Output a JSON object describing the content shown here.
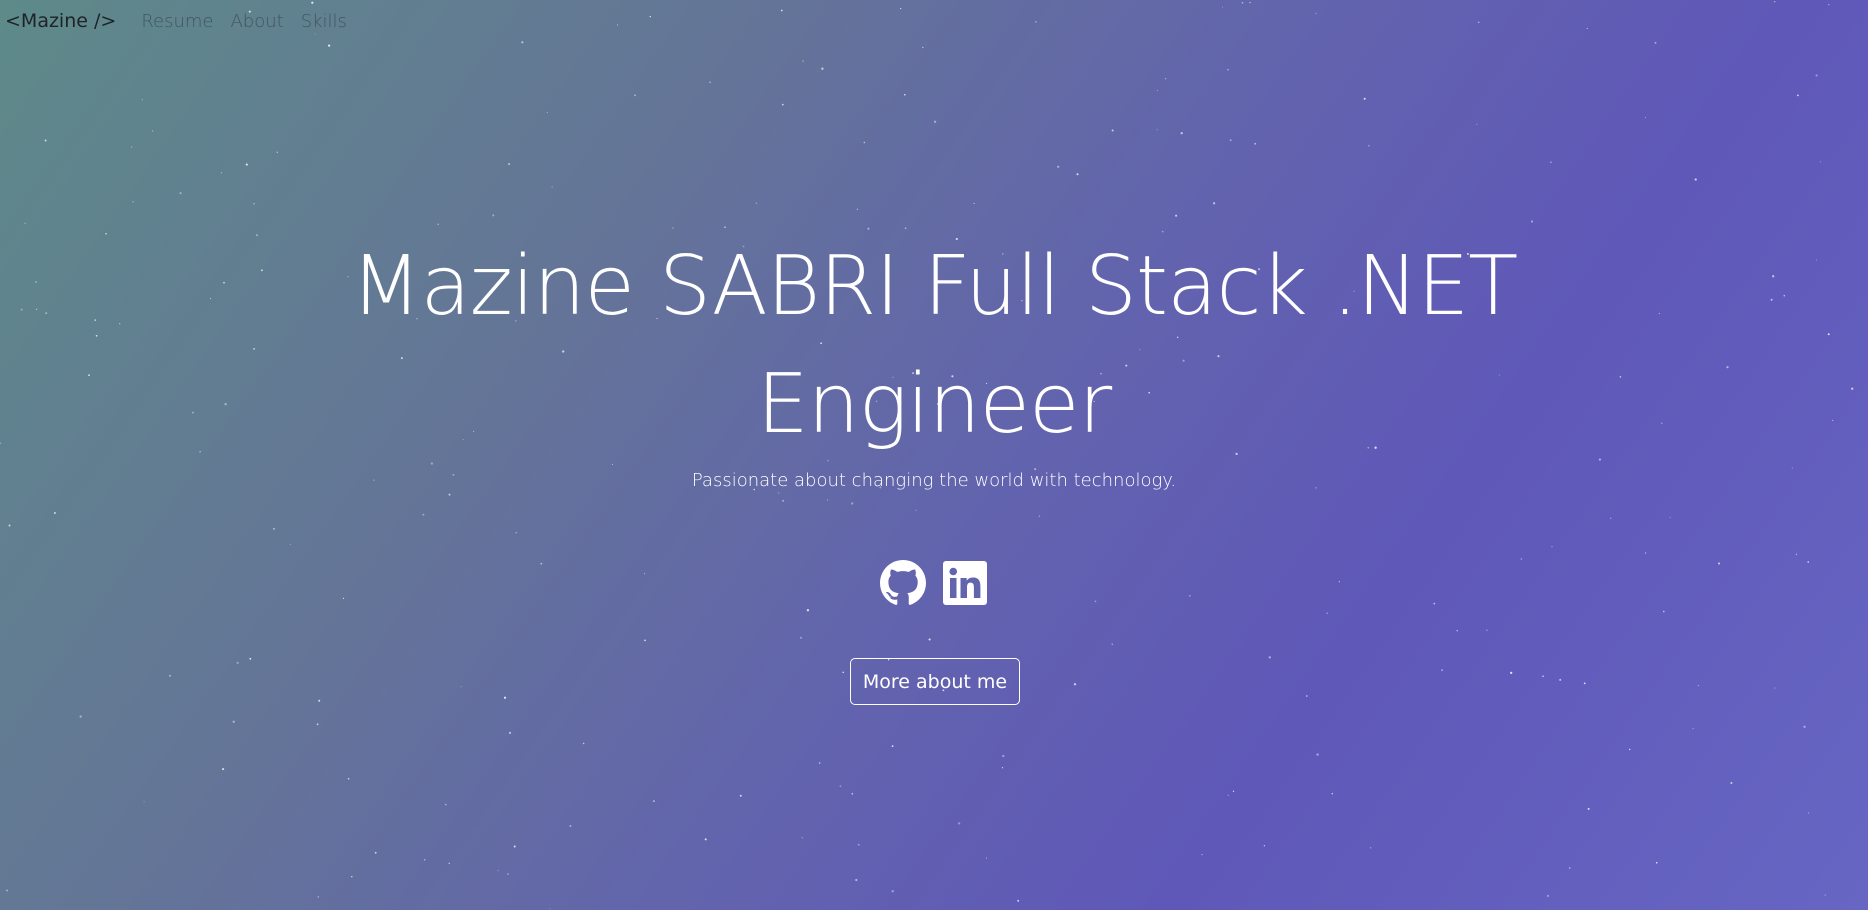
{
  "navbar": {
    "brand": "<Mazine />",
    "links": [
      "Resume",
      "About",
      "Skills"
    ]
  },
  "hero": {
    "title": "Mazine SABRI Full Stack .NET Engineer",
    "subtitle": "Passionate about changing the world with technology.",
    "cta_label": "More about me"
  },
  "social": [
    {
      "icon": "github-icon"
    },
    {
      "icon": "linkedin-icon"
    }
  ],
  "colors": {
    "gradient_start": "#5e8a89",
    "gradient_mid": "#6262af",
    "gradient_end": "#6766c3",
    "text": "#ffffff",
    "brand_text": "#1e2326"
  }
}
